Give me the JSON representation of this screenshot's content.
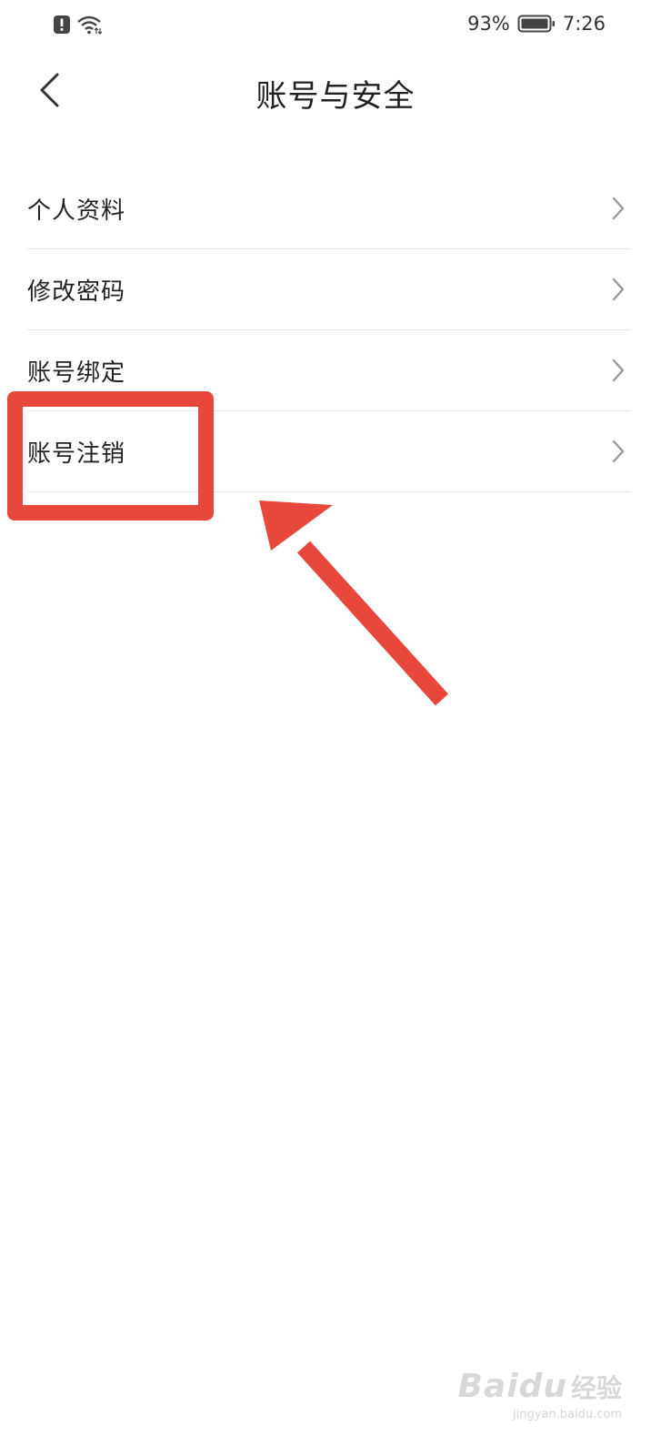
{
  "status_bar": {
    "battery_percent": "93%",
    "time": "7:26"
  },
  "header": {
    "title": "账号与安全"
  },
  "menu": {
    "items": [
      {
        "label": "个人资料"
      },
      {
        "label": "修改密码"
      },
      {
        "label": "账号绑定"
      },
      {
        "label": "账号注销"
      }
    ]
  },
  "annotation": {
    "color": "#e8473c"
  },
  "watermark": {
    "brand": "Baidu",
    "suffix": "经验",
    "url": "jingyan.baidu.com"
  },
  "icons": [
    "alert-icon",
    "wifi-icon",
    "battery-icon",
    "back-icon",
    "chevron-right-icon"
  ]
}
